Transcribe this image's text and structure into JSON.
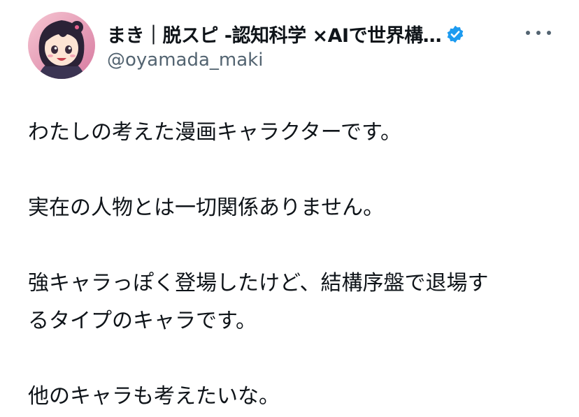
{
  "author": {
    "display_name": "まき｜脱スピ -認知科学 ×AIで世界構…",
    "handle": "@oyamada_maki",
    "avatar_icon": "anime-girl-avatar-icon",
    "verified_icon": "verified-badge-icon",
    "verified_color": "#1d9bf0"
  },
  "actions": {
    "more_icon": "more-options-icon"
  },
  "tweet": {
    "paragraphs": [
      "わたしの考えた漫画キャラクターです。",
      "実在の人物とは一切関係ありません。",
      "強キャラっぽく登場したけど、結構序盤で退場す\nるタイプのキャラです。",
      "他のキャラも考えたいな。"
    ]
  },
  "colors": {
    "text_primary": "#0f1419",
    "text_secondary": "#536471",
    "avatar_bg": "#e8b7c6"
  }
}
